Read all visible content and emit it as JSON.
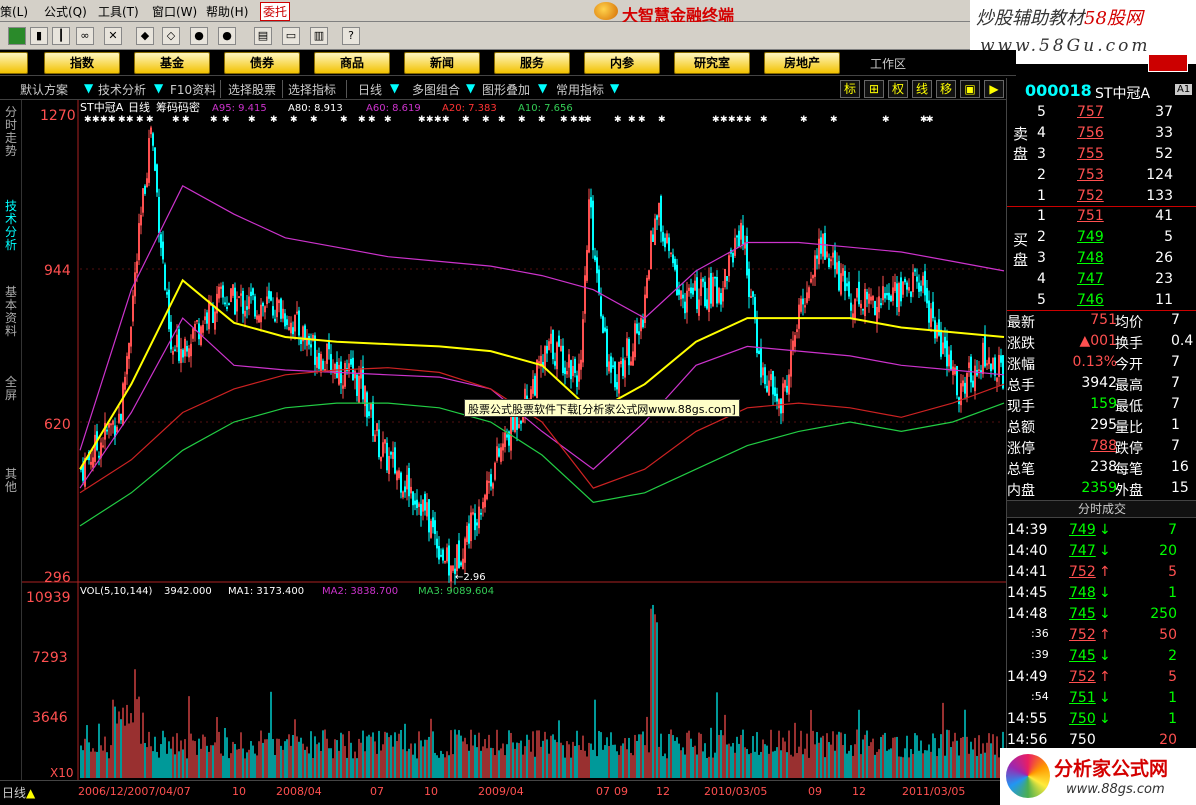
{
  "menubar": {
    "items": [
      "策(L)",
      "公式(Q)",
      "工具(T)",
      "窗口(W)",
      "帮助(H)"
    ],
    "highlight": "委托",
    "brand": "大智慧金融终端"
  },
  "watermark": {
    "top_line": "炒股辅助教材",
    "top_red": "58股网",
    "top_url": "www.58Gu.com",
    "bottom_title": "分析家公式网",
    "bottom_url": "www.88gs.com"
  },
  "categories": [
    "股",
    "指数",
    "基金",
    "债券",
    "商品",
    "新闻",
    "服务",
    "内参",
    "研究室",
    "房地产"
  ],
  "workzone": "工作区",
  "funcbar": {
    "items": [
      "默认方案",
      "技术分析",
      "F10资料",
      "选择股票",
      "选择指标",
      "日线",
      "多图组合",
      "图形叠加",
      "常用指标"
    ],
    "right_buttons": [
      "标",
      "⊞",
      "权",
      "线",
      "移",
      "▣",
      "▶"
    ]
  },
  "lefttabs": [
    "分时走势",
    "技术分析",
    "基本资料",
    "全屏",
    "其他"
  ],
  "chart_header": {
    "stock": "ST中冠A",
    "period": "日线",
    "indicator": "筹码码密",
    "a95": "A95: 9.415",
    "a80": "A80: 8.913",
    "a60": "A60: 8.619",
    "a20": "A20: 7.383",
    "a10": "A10: 7.656"
  },
  "volume_header": {
    "label": "VOL(5,10,144)",
    "vol": "3942.000",
    "ma1": "MA1: 3173.400",
    "ma2": "MA2: 3838.700",
    "ma3": "MA3: 9089.604"
  },
  "price_axis": [
    "1270",
    "944",
    "620",
    "296"
  ],
  "volume_axis": [
    "10939",
    "7293",
    "3646",
    "X10"
  ],
  "low_label": "2.96",
  "date_axis": [
    "2006/12/2007/04/07",
    "10",
    "2008/04",
    "07",
    "10",
    "2009/04",
    "07",
    "09",
    "12",
    "2010/03/05",
    "09",
    "12",
    "2011/03/05"
  ],
  "tooltip": "股票公式股票软件下载[分析家公式网www.88gs.com]",
  "status": {
    "left": "日线",
    "arrow": "▲"
  },
  "quote": {
    "code": "000018",
    "name": "ST中冠A",
    "tag": "A1",
    "sell_label": "卖盘",
    "buy_label": "买盘",
    "sell": [
      {
        "idx": "5",
        "price": "757",
        "vol": "37"
      },
      {
        "idx": "4",
        "price": "756",
        "vol": "33"
      },
      {
        "idx": "3",
        "price": "755",
        "vol": "52"
      },
      {
        "idx": "2",
        "price": "753",
        "vol": "124"
      },
      {
        "idx": "1",
        "price": "752",
        "vol": "133"
      }
    ],
    "buy": [
      {
        "idx": "1",
        "price": "751",
        "vol": "41"
      },
      {
        "idx": "2",
        "price": "749",
        "vol": "5"
      },
      {
        "idx": "3",
        "price": "748",
        "vol": "26"
      },
      {
        "idx": "4",
        "price": "747",
        "vol": "23"
      },
      {
        "idx": "5",
        "price": "746",
        "vol": "11"
      }
    ],
    "stats": [
      {
        "k": "最新",
        "v": "751",
        "k2": "均价",
        "v2": "7"
      },
      {
        "k": "涨跌",
        "v": "▲001",
        "k2": "换手",
        "v2": "0.4"
      },
      {
        "k": "涨幅",
        "v": "0.13%",
        "k2": "今开",
        "v2": "7"
      },
      {
        "k": "总手",
        "v": "3942",
        "k2": "最高",
        "v2": "7"
      },
      {
        "k": "现手",
        "v": "159",
        "k2": "最低",
        "v2": "7"
      },
      {
        "k": "总额",
        "v": "295",
        "k2": "量比",
        "v2": "1"
      },
      {
        "k": "涨停",
        "v": "788",
        "k2": "跌停",
        "v2": "7"
      },
      {
        "k": "总笔",
        "v": "238",
        "k2": "每笔",
        "v2": "16"
      },
      {
        "k": "内盘",
        "v": "2359",
        "k2": "外盘",
        "v2": "15"
      }
    ],
    "tick_title": "分时成交",
    "ticks": [
      {
        "t": "14:39",
        "p": "749",
        "dir": "down",
        "v": "7"
      },
      {
        "t": "14:40",
        "p": "747",
        "dir": "down",
        "v": "20"
      },
      {
        "t": "14:41",
        "p": "752",
        "dir": "up",
        "v": "5"
      },
      {
        "t": "14:45",
        "p": "748",
        "dir": "down",
        "v": "1"
      },
      {
        "t": "14:48",
        "p": "745",
        "dir": "down",
        "v": "250"
      },
      {
        "t": ":36",
        "p": "752",
        "dir": "up",
        "v": "50"
      },
      {
        "t": ":39",
        "p": "745",
        "dir": "down",
        "v": "2"
      },
      {
        "t": "14:49",
        "p": "752",
        "dir": "up",
        "v": "5"
      },
      {
        "t": ":54",
        "p": "751",
        "dir": "down",
        "v": "1"
      },
      {
        "t": "14:55",
        "p": "750",
        "dir": "down",
        "v": "1"
      },
      {
        "t": "14:56",
        "p": "750",
        "dir": "none",
        "v": "20"
      }
    ]
  },
  "colors": {
    "up": "#ff5050",
    "down": "#00ffff",
    "green_price": "#00ff00",
    "yellow_line": "#ffff00",
    "magenta_line": "#cc33cc",
    "red_line": "#cc2222",
    "green_line": "#22cc44"
  },
  "chart_data": {
    "type": "line",
    "title": "ST中冠A 日线",
    "ylim": [
      296,
      1270
    ],
    "bands": [
      {
        "name": "A95",
        "values": [
          560,
          900,
          1120,
          1060,
          1010,
          990,
          970,
          960,
          950,
          930,
          900,
          840,
          940,
          1000,
          1000,
          990,
          980,
          960,
          940
        ]
      },
      {
        "name": "A80",
        "values": [
          520,
          700,
          920,
          830,
          800,
          790,
          785,
          780,
          770,
          740,
          640,
          700,
          790,
          840,
          840,
          840,
          820,
          810,
          800
        ]
      },
      {
        "name": "A60",
        "values": [
          480,
          640,
          840,
          740,
          730,
          725,
          720,
          715,
          690,
          600,
          520,
          620,
          740,
          780,
          770,
          760,
          740,
          730,
          720
        ]
      },
      {
        "name": "A20",
        "values": [
          470,
          540,
          640,
          690,
          720,
          730,
          735,
          725,
          690,
          620,
          480,
          520,
          600,
          650,
          660,
          650,
          630,
          660,
          700
        ]
      },
      {
        "name": "A10",
        "values": [
          400,
          470,
          560,
          620,
          650,
          660,
          660,
          650,
          620,
          550,
          450,
          470,
          520,
          570,
          600,
          620,
          600,
          620,
          660
        ]
      }
    ]
  }
}
